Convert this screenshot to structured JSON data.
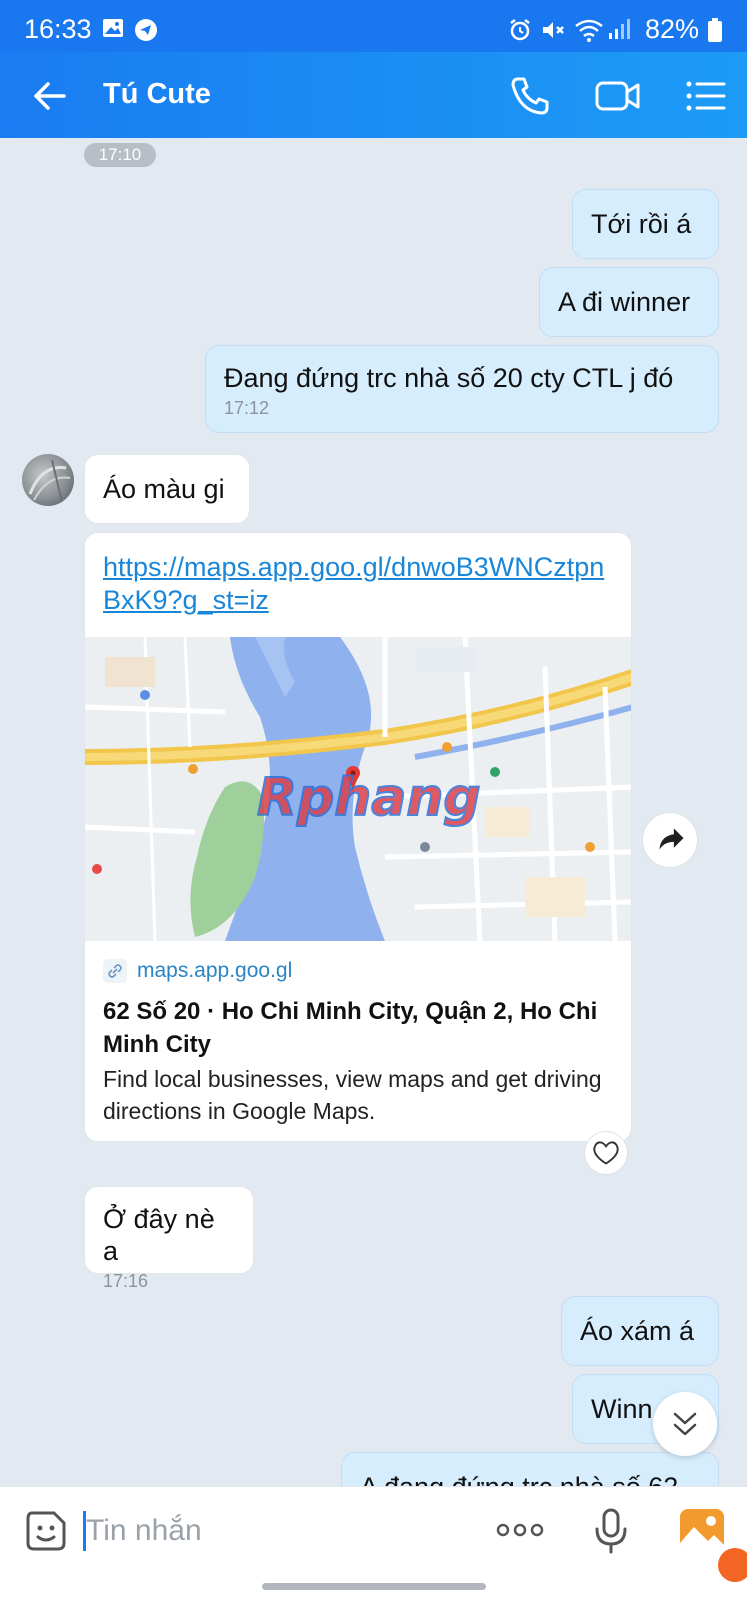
{
  "status_bar": {
    "time": "16:33",
    "battery": "82%"
  },
  "header": {
    "title": "Tú Cute"
  },
  "messages": {
    "time_chip": "17:10",
    "out1": "Tới rồi á",
    "out2": "A đi winner",
    "out3": {
      "text": "Đang đứng trc nhà số 20 cty CTL j đó",
      "time": "17:12"
    },
    "in1": "Áo màu gi",
    "link_card": {
      "url": "https://maps.app.goo.gl/dnwoB3WNCztpnBxK9?g_st=iz",
      "domain": "maps.app.goo.gl",
      "title": "62 Số 20 · Ho Chi Minh City, Quận 2, Ho Chi Minh City",
      "description": "Find local businesses, view maps and get driving directions in Google Maps.",
      "watermark": "Rphang"
    },
    "in2": {
      "text": "Ở đây nè a",
      "time": "17:16"
    },
    "out4": "Áo xám á",
    "out5": "Winn",
    "out6": "A đang đứng trc nhà số 62"
  },
  "input": {
    "placeholder": "Tin nhắn",
    "value": ""
  },
  "icons": {
    "back": "arrow-left-icon",
    "call": "phone-icon",
    "video": "video-call-icon",
    "menu": "list-menu-icon",
    "emoji": "sticker-icon",
    "more": "more-dots-icon",
    "mic": "microphone-icon",
    "gallery": "image-gallery-icon",
    "share": "share-forward-icon",
    "heart": "heart-icon",
    "scroll": "scroll-down-icon"
  },
  "colors": {
    "accent": "#1a7cf2",
    "outgoing_bubble": "#d6edfe",
    "incoming_bubble": "#ffffff",
    "link": "#1a86d8"
  }
}
